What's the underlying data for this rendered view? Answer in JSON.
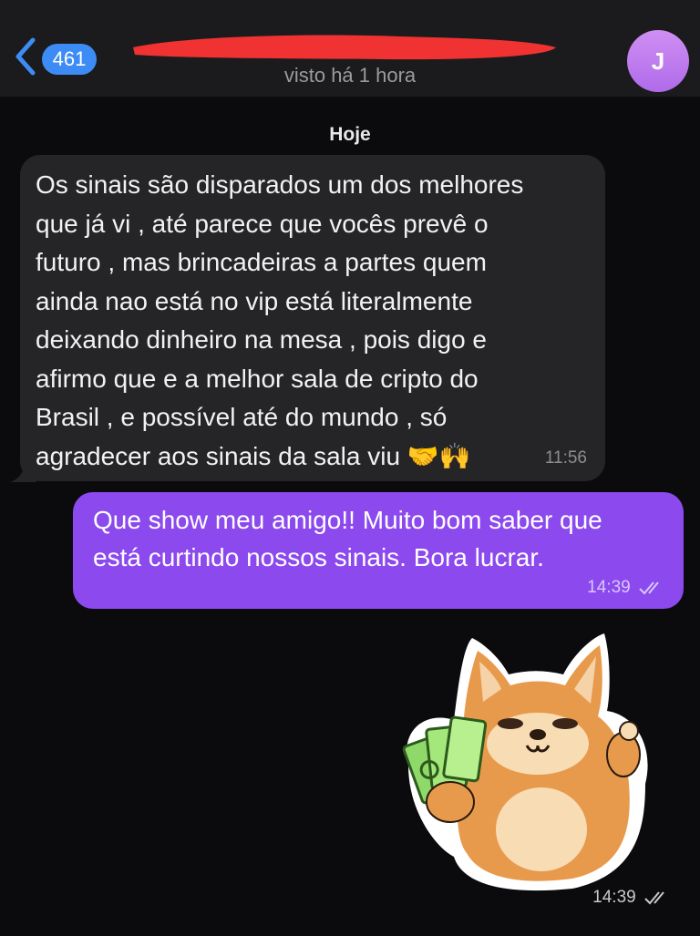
{
  "header": {
    "unread_count": "461",
    "contact_status": "visto há 1 hora",
    "avatar_letter": "J"
  },
  "chat": {
    "date_label": "Hoje",
    "incoming": {
      "text": "Os sinais são disparados um dos melhores\nque já vi , até parece que vocês prevê o\nfuturo , mas brincadeiras a partes quem\nainda nao está no vip está literalmente\ndeixando dinheiro na mesa , pois digo e\nafirmo que e a melhor sala de cripto do\nBrasil , e possível até do mundo , só\nagradecer aos sinais da sala viu",
      "emojis": "🤝🙌",
      "time": "11:56"
    },
    "outgoing": {
      "text": "Que show meu amigo!! Muito bom saber que\nestá curtindo nossos sinais. Bora lucrar.",
      "time": "14:39"
    },
    "sticker": {
      "time": "14:39"
    }
  },
  "colors": {
    "background": "#0b0b0d",
    "header": "#1b1b1d",
    "incoming_bubble": "#252527",
    "outgoing_bubble": "#8b49ee",
    "accent_blue": "#3d8cf5",
    "avatar": "#c07ef0"
  }
}
